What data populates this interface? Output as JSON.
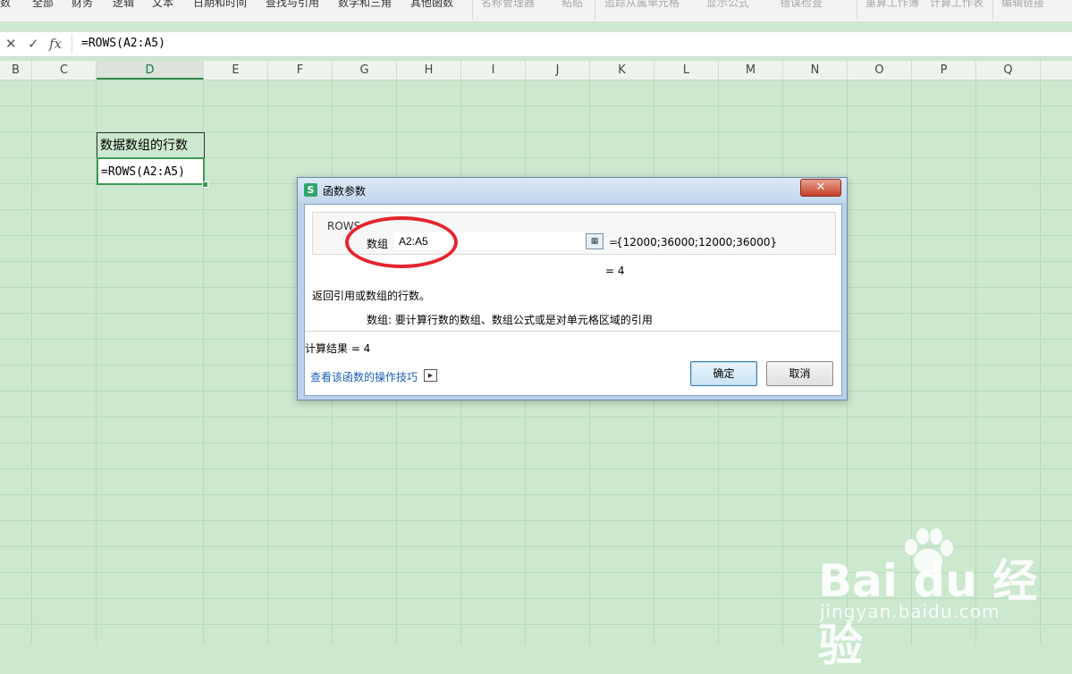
{
  "ribbon": {
    "items": [
      "数",
      "全部",
      "财务",
      "逻辑",
      "文本",
      "日期和时间",
      "查找与引用",
      "数学和三角",
      "其他函数",
      "名称管理器",
      "粘贴",
      "追踪从属单元格",
      "显示公式",
      "错误检查",
      "重算工作簿",
      "计算工作表",
      "编辑链接"
    ]
  },
  "formula_bar": {
    "cancel_icon": "close-icon",
    "confirm_icon": "check-icon",
    "fx_label": "fx",
    "formula": "=ROWS(A2:A5)"
  },
  "columns": [
    "B",
    "C",
    "D",
    "E",
    "F",
    "G",
    "H",
    "I",
    "J",
    "K",
    "L",
    "M",
    "N",
    "O",
    "P",
    "Q"
  ],
  "active_column": "D",
  "cells": {
    "d4": "数据数组的行数",
    "d5": "=ROWS(A2:A5)"
  },
  "dialog": {
    "title": "函数参数",
    "app_icon_letter": "S",
    "close_symbol": "✕",
    "function_name": "ROWS",
    "arg_label": "数组",
    "arg_value": "A2:A5",
    "arg_eq": "=",
    "arg_result": "{12000;36000;12000;36000}",
    "inline_result": "=  4",
    "description": "返回引用或数组的行数。",
    "arg_description": "数组:  要计算行数的数组、数组公式或是对单元格区域的引用",
    "calc_result": "计算结果  =  4",
    "help_link": "查看该函数的操作技巧",
    "ok_label": "确定",
    "cancel_label": "取消"
  },
  "watermark": {
    "brand": "Bai du 经验",
    "url": "jingyan.baidu.com"
  },
  "colors": {
    "sheet_bg": "#cce8cf",
    "selection": "#3c9a50",
    "annotation": "#e5252f",
    "link": "#1a5fb4"
  }
}
